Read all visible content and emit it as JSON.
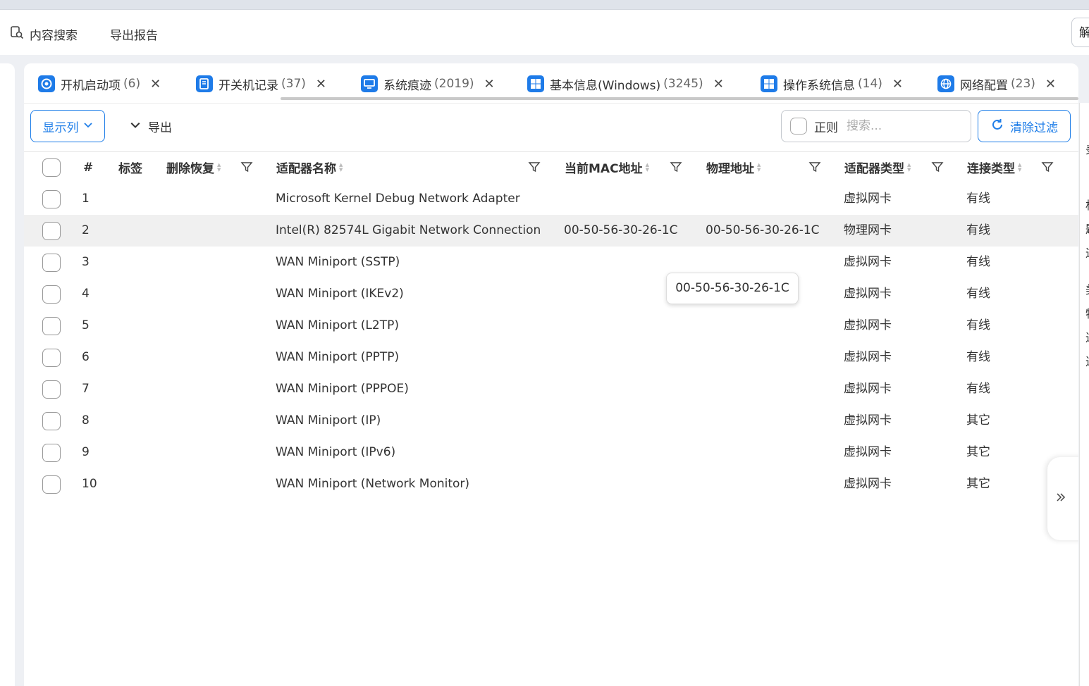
{
  "toolbar": {
    "content_search": "内容搜索",
    "export_report": "导出报告",
    "right_button_label": "解"
  },
  "tabs": [
    {
      "label": "开机启动项",
      "count": "(6)",
      "icon": "startup-icon"
    },
    {
      "label": "开关机记录",
      "count": "(37)",
      "icon": "power-log-icon"
    },
    {
      "label": "系统痕迹",
      "count": "(2019)",
      "icon": "monitor-icon"
    },
    {
      "label": "基本信息(Windows)",
      "count": "(3245)",
      "icon": "windows-icon"
    },
    {
      "label": "操作系统信息",
      "count": "(14)",
      "icon": "windows-icon"
    },
    {
      "label": "网络配置",
      "count": "(23)",
      "icon": "globe-icon"
    }
  ],
  "controls": {
    "show_columns": "显示列",
    "export": "导出",
    "regex_label": "正则",
    "search_placeholder": "搜索...",
    "clear_filter": "清除过滤"
  },
  "table": {
    "columns": {
      "index": "#",
      "tag": "标签",
      "deleted": "删除恢复",
      "adapter_name": "适配器名称",
      "mac": "当前MAC地址",
      "physical": "物理地址",
      "adapter_type": "适配器类型",
      "conn_type": "连接类型"
    },
    "rows": [
      {
        "index": "1",
        "adapter_name": "Microsoft Kernel Debug Network Adapter",
        "mac": "",
        "physical": "",
        "adapter_type": "虚拟网卡",
        "conn_type": "有线"
      },
      {
        "index": "2",
        "adapter_name": "Intel(R) 82574L Gigabit Network Connection",
        "mac": "00-50-56-30-26-1C",
        "physical": "00-50-56-30-26-1C",
        "adapter_type": "物理网卡",
        "conn_type": "有线"
      },
      {
        "index": "3",
        "adapter_name": "WAN Miniport (SSTP)",
        "mac": "",
        "physical": "",
        "adapter_type": "虚拟网卡",
        "conn_type": "有线"
      },
      {
        "index": "4",
        "adapter_name": "WAN Miniport (IKEv2)",
        "mac": "",
        "physical": "",
        "adapter_type": "虚拟网卡",
        "conn_type": "有线"
      },
      {
        "index": "5",
        "adapter_name": "WAN Miniport (L2TP)",
        "mac": "",
        "physical": "",
        "adapter_type": "虚拟网卡",
        "conn_type": "有线"
      },
      {
        "index": "6",
        "adapter_name": "WAN Miniport (PPTP)",
        "mac": "",
        "physical": "",
        "adapter_type": "虚拟网卡",
        "conn_type": "有线"
      },
      {
        "index": "7",
        "adapter_name": "WAN Miniport (PPPOE)",
        "mac": "",
        "physical": "",
        "adapter_type": "虚拟网卡",
        "conn_type": "有线"
      },
      {
        "index": "8",
        "adapter_name": "WAN Miniport (IP)",
        "mac": "",
        "physical": "",
        "adapter_type": "虚拟网卡",
        "conn_type": "其它"
      },
      {
        "index": "9",
        "adapter_name": "WAN Miniport (IPv6)",
        "mac": "",
        "physical": "",
        "adapter_type": "虚拟网卡",
        "conn_type": "其它"
      },
      {
        "index": "10",
        "adapter_name": "WAN Miniport (Network Monitor)",
        "mac": "",
        "physical": "",
        "adapter_type": "虚拟网卡",
        "conn_type": "其它"
      }
    ]
  },
  "tooltip": "00-50-56-30-26-1C",
  "right_panel_chars": [
    "录",
    "析",
    "题",
    "进",
    "美",
    "特",
    "进",
    "进"
  ],
  "colors": {
    "accent": "#1f7ee8",
    "highlight_row": "#f0f0f0"
  }
}
